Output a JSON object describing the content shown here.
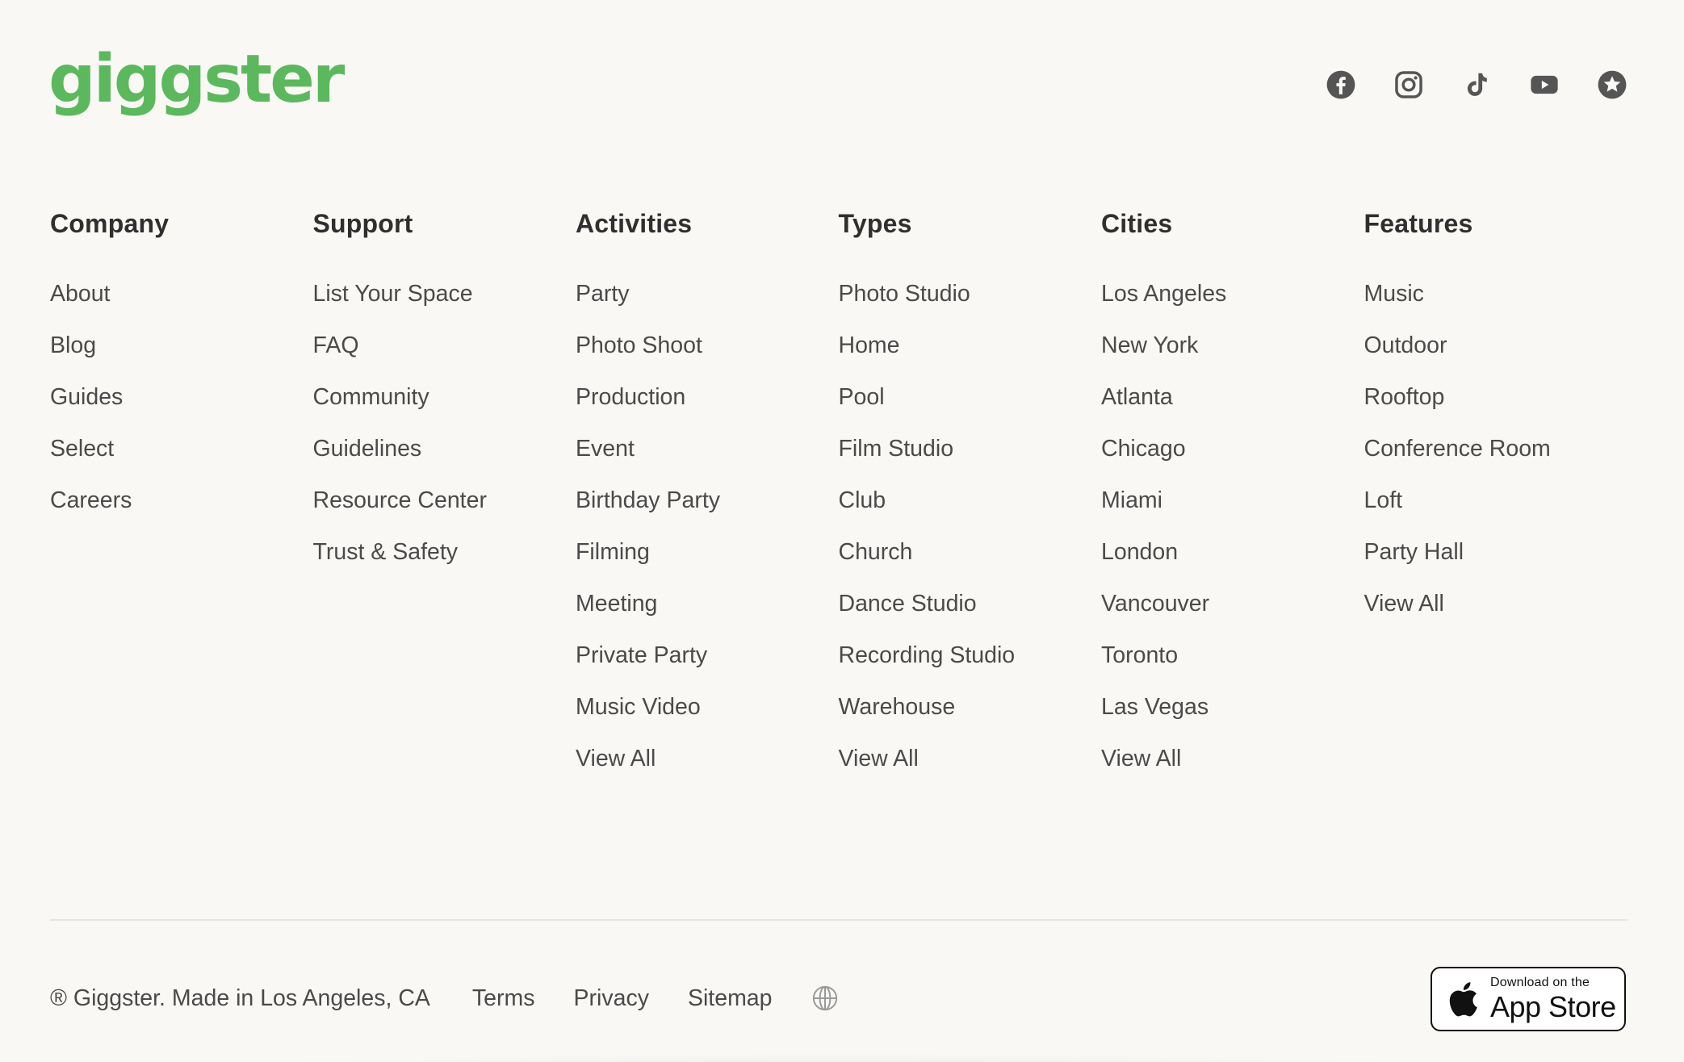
{
  "brand": {
    "logo_text": "giggster",
    "color": "#5cb85c"
  },
  "social": [
    "facebook-icon",
    "instagram-icon",
    "tiktok-icon",
    "youtube-icon",
    "review-star-icon"
  ],
  "columns": [
    {
      "title": "Company",
      "items": [
        "About",
        "Blog",
        "Guides",
        "Select",
        "Careers"
      ]
    },
    {
      "title": "Support",
      "items": [
        "List Your Space",
        "FAQ",
        "Community",
        "Guidelines",
        "Resource Center",
        "Trust & Safety"
      ]
    },
    {
      "title": "Activities",
      "items": [
        "Party",
        "Photo Shoot",
        "Production",
        "Event",
        "Birthday Party",
        "Filming",
        "Meeting",
        "Private Party",
        "Music Video",
        "View All"
      ]
    },
    {
      "title": "Types",
      "items": [
        "Photo Studio",
        "Home",
        "Pool",
        "Film Studio",
        "Club",
        "Church",
        "Dance Studio",
        "Recording Studio",
        "Warehouse",
        "View All"
      ]
    },
    {
      "title": "Cities",
      "items": [
        "Los Angeles",
        "New York",
        "Atlanta",
        "Chicago",
        "Miami",
        "London",
        "Vancouver",
        "Toronto",
        "Las Vegas",
        "View All"
      ]
    },
    {
      "title": "Features",
      "items": [
        "Music",
        "Outdoor",
        "Rooftop",
        "Conference Room",
        "Loft",
        "Party Hall",
        "View All"
      ]
    }
  ],
  "bottom": {
    "copyright": "® Giggster. Made in Los Angeles, CA",
    "links": [
      "Terms",
      "Privacy",
      "Sitemap"
    ],
    "globe_icon": "globe-icon"
  },
  "appstore": {
    "small": "Download on the",
    "big": "App Store"
  }
}
